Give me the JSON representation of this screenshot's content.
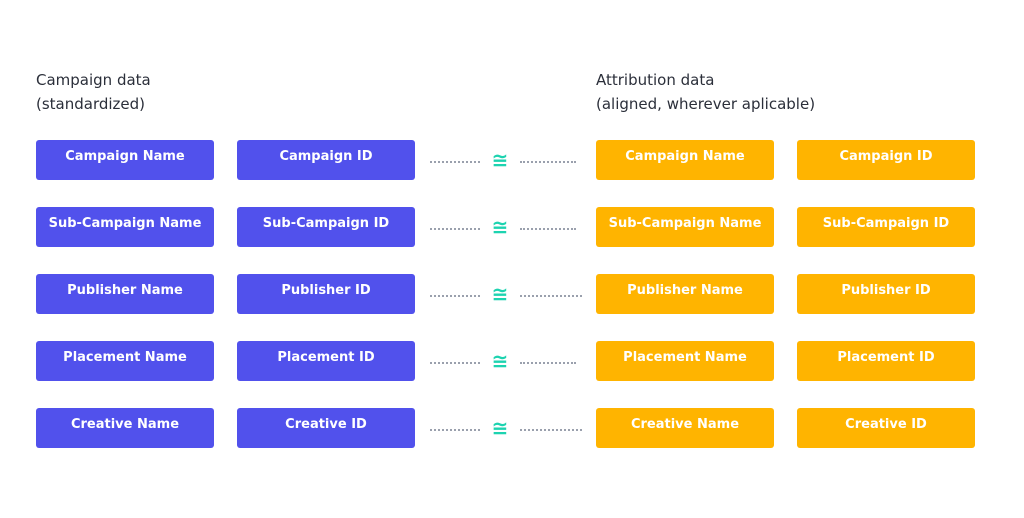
{
  "left": {
    "title_line1": "Campaign data",
    "title_line2": "(standardized)",
    "color": "#5151ec"
  },
  "right": {
    "title_line1": "Attribution data",
    "title_line2": "(aligned, wherever aplicable)",
    "color": "#ffb400"
  },
  "connector": {
    "icon": "approximately-equal-icon",
    "glyph": "≅",
    "color": "#1dd3b0"
  },
  "rows": [
    {
      "left_name": "Campaign Name",
      "left_id": "Campaign ID",
      "right_name": "Campaign Name",
      "right_id": "Campaign ID"
    },
    {
      "left_name": "Sub-Campaign Name",
      "left_id": "Sub-Campaign ID",
      "right_name": "Sub-Campaign Name",
      "right_id": "Sub-Campaign ID"
    },
    {
      "left_name": "Publisher Name",
      "left_id": "Publisher ID",
      "right_name": "Publisher Name",
      "right_id": "Publisher ID"
    },
    {
      "left_name": "Placement Name",
      "left_id": "Placement ID",
      "right_name": "Placement Name",
      "right_id": "Placement ID"
    },
    {
      "left_name": "Creative Name",
      "left_id": "Creative ID",
      "right_name": "Creative Name",
      "right_id": "Creative ID"
    }
  ]
}
